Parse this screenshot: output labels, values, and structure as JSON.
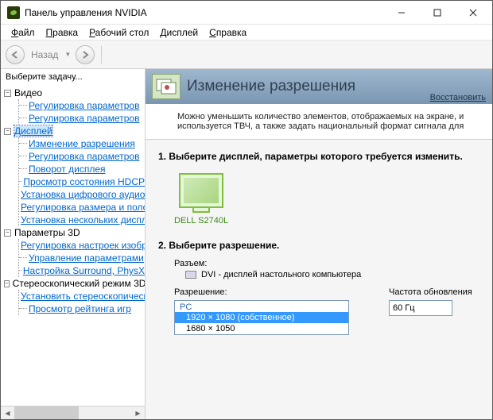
{
  "title": "Панель управления NVIDIA",
  "menu": {
    "file": "Файл",
    "edit": "Правка",
    "desktop": "Рабочий стол",
    "display": "Дисплей",
    "help": "Справка"
  },
  "nav": {
    "back": "Назад"
  },
  "sidebar": {
    "title": "Выберите задачу...",
    "video": {
      "label": "Видео",
      "items": [
        "Регулировка параметров",
        "Регулировка параметров"
      ]
    },
    "display": {
      "label": "Дисплей",
      "items": [
        "Изменение разрешения",
        "Регулировка параметров",
        "Поворот дисплея",
        "Просмотр состояния HDCP",
        "Установка цифрового аудио",
        "Регулировка размера и положения",
        "Установка нескольких дисплеев"
      ]
    },
    "params3d": {
      "label": "Параметры 3D",
      "items": [
        "Регулировка настроек изображения",
        "Управление параметрами",
        "Настройка Surround, PhysX"
      ]
    },
    "stereo": {
      "label": "Стереоскопический режим 3D",
      "items": [
        "Установить стереоскопический режим",
        "Просмотр рейтинга игр"
      ]
    }
  },
  "main": {
    "title": "Изменение разрешения",
    "restore": "Восстановить",
    "desc": "Можно уменьшить количество элементов, отображаемых на экране, и используется ТВЧ, а также задать национальный формат сигнала для",
    "step1": "1. Выберите дисплей, параметры которого требуется изменить.",
    "monitor": "DELL S2740L",
    "step2": "2. Выберите разрешение.",
    "connector_label": "Разъем:",
    "connector_value": "DVI - дисплей настольного компьютера",
    "resolution_label": "Разрешение:",
    "refresh_label": "Частота обновления",
    "refresh_value": "60 Гц",
    "res_group": "PC",
    "res_options": [
      "1920 × 1080 (собственное)",
      "1680 × 1050"
    ]
  }
}
